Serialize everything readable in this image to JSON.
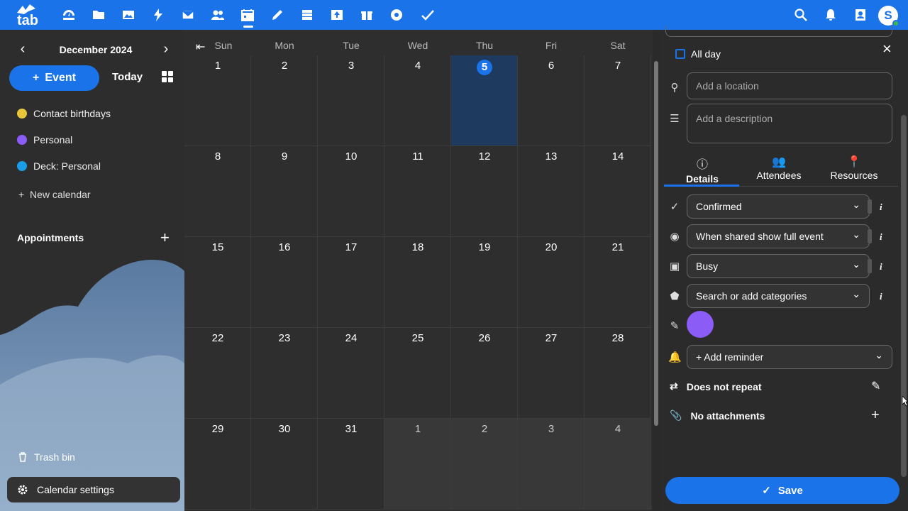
{
  "app": {
    "logo_text": "tab",
    "apps": [
      "dashboard",
      "files",
      "photos",
      "activity",
      "mail",
      "contacts",
      "calendar",
      "notes",
      "deck",
      "upgrade",
      "free",
      "email",
      "tasks"
    ],
    "user_initial": "S"
  },
  "sidebar": {
    "month_label": "December 2024",
    "event_label": "Event",
    "today_label": "Today",
    "calendars": [
      {
        "label": "Contact birthdays",
        "color": "#e8c53b"
      },
      {
        "label": "Personal",
        "color": "#8b5cf6"
      },
      {
        "label": "Deck: Personal",
        "color": "#1a9de8"
      }
    ],
    "new_calendar_label": "New calendar",
    "appointments_label": "Appointments",
    "trash_label": "Trash bin",
    "settings_label": "Calendar settings"
  },
  "calendar": {
    "day_names": [
      "Sun",
      "Mon",
      "Tue",
      "Wed",
      "Thu",
      "Fri",
      "Sat"
    ],
    "weeks": [
      [
        "1",
        "2",
        "3",
        "4",
        "5",
        "6",
        "7"
      ],
      [
        "8",
        "9",
        "10",
        "11",
        "12",
        "13",
        "14"
      ],
      [
        "15",
        "16",
        "17",
        "18",
        "19",
        "20",
        "21"
      ],
      [
        "22",
        "23",
        "24",
        "25",
        "26",
        "27",
        "28"
      ],
      [
        "29",
        "30",
        "31",
        "1",
        "2",
        "3",
        "4"
      ]
    ],
    "today": "5"
  },
  "panel": {
    "all_day_label": "All day",
    "location_placeholder": "Add a location",
    "description_placeholder": "Add a description",
    "tabs": [
      {
        "label": "Details",
        "icon": "info-icon"
      },
      {
        "label": "Attendees",
        "icon": "people-icon"
      },
      {
        "label": "Resources",
        "icon": "pin-icon"
      }
    ],
    "status_value": "Confirmed",
    "visibility_value": "When shared show full event",
    "availability_value": "Busy",
    "categories_placeholder": "Search or add categories",
    "event_color": "#8b5cf6",
    "reminder_label": "+ Add reminder",
    "repeat_label": "Does not repeat",
    "attachments_label": "No attachments",
    "save_label": "Save"
  }
}
